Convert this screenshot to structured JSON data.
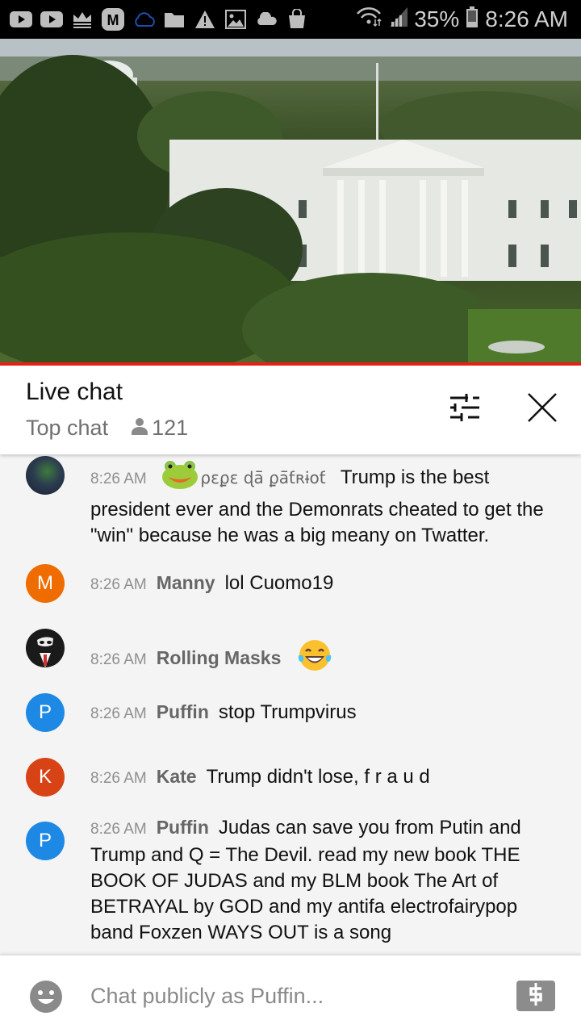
{
  "status_bar": {
    "notification_icons": [
      "youtube-icon",
      "youtube-icon",
      "crown-icon",
      "m-app-icon",
      "cloud-outline-icon",
      "folder-icon",
      "warning-icon",
      "image-icon",
      "cloud-icon",
      "shopping-bag-icon"
    ],
    "battery_percent": "35%",
    "time": "8:26 AM"
  },
  "video": {
    "description": "Live camera view of the White House"
  },
  "header": {
    "title": "Live chat",
    "mode": "Top chat",
    "viewer_count": "121"
  },
  "messages": [
    {
      "timestamp": "8:26 AM",
      "author": "ρεϼε ɖā̄ ϼā̄ƭʀɨoƭ",
      "author_emoji": "🐸",
      "text": "Trump is the best president ever and the Demonrats cheated to get the \"win\" because he was a big meany on Twatter.",
      "avatar": {
        "type": "photo",
        "color": "#3a4a5a"
      }
    },
    {
      "timestamp": "8:26 AM",
      "author": "Manny",
      "text": "lol Cuomo19",
      "avatar": {
        "type": "letter",
        "letter": "M",
        "color": "#ef6c00"
      }
    },
    {
      "timestamp": "8:26 AM",
      "author": "Rolling Masks",
      "text": "😂",
      "avatar": {
        "type": "photo",
        "color": "#1a1a1a"
      }
    },
    {
      "timestamp": "8:26 AM",
      "author": "Puffin",
      "text": "stop Trumpvirus",
      "avatar": {
        "type": "letter",
        "letter": "P",
        "color": "#1e88e5"
      }
    },
    {
      "timestamp": "8:26 AM",
      "author": "Kate",
      "text": "Trump didn't lose, f r a u d",
      "avatar": {
        "type": "letter",
        "letter": "K",
        "color": "#d84315"
      }
    },
    {
      "timestamp": "8:26 AM",
      "author": "Puffin",
      "text": "Judas can save you from Putin and Trump and Q = The Devil. read my new book THE BOOK OF JUDAS and my BLM book The Art of BETRAYAL by GOD and my antifa electrofairypop band Foxzen WAYS OUT is a song",
      "avatar": {
        "type": "letter",
        "letter": "P",
        "color": "#1e88e5"
      }
    }
  ],
  "footer": {
    "input_placeholder": "Chat publicly as Puffin...",
    "input_value": ""
  },
  "colors": {
    "accent_red": "#e62117"
  }
}
